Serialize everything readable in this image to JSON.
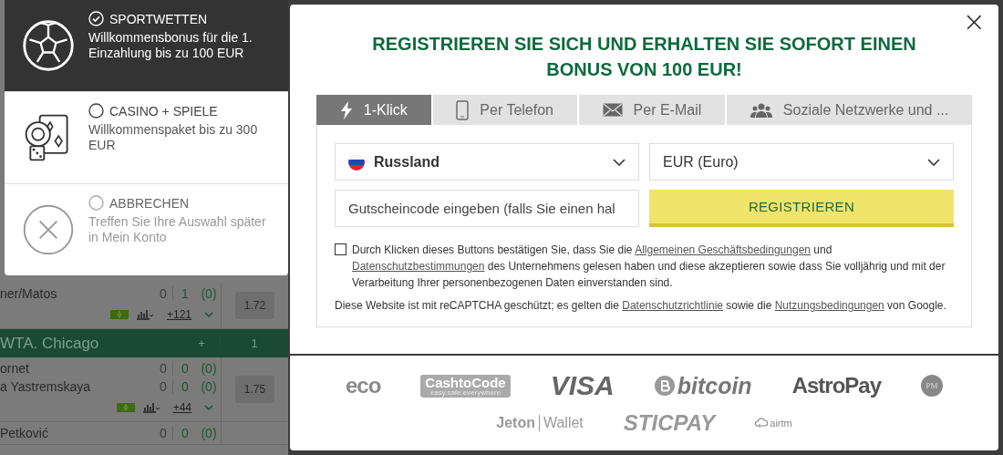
{
  "background": {
    "events": [
      {
        "kind": "match",
        "teams": [
          {
            "name": "ner/Matos",
            "score": "0",
            "games": "1",
            "points": "(0)"
          }
        ],
        "odds": "1.72",
        "markets": "+121"
      },
      {
        "kind": "league",
        "name": "WTA. Chicago",
        "plus": "+",
        "count": "1"
      },
      {
        "kind": "match",
        "teams": [
          {
            "name": "ornet",
            "score": "0",
            "games": "0",
            "points": "(0)"
          },
          {
            "name": "a Yastremskaya",
            "score": "0",
            "games": "0",
            "points": "(0)"
          }
        ],
        "odds": "1.75",
        "markets": "+44"
      },
      {
        "kind": "match",
        "teams": [
          {
            "name": "Petković",
            "score": "0",
            "games": "0",
            "points": "(0)"
          }
        ]
      }
    ]
  },
  "bonus_menu": {
    "options": [
      {
        "kind": "sport",
        "title": "SPORTWETTEN",
        "text": "Willkommensbonus für die 1. Einzahlung bis zu 100 EUR",
        "selected": true,
        "muted": false
      },
      {
        "kind": "casino",
        "title": "CASINO + SPIELE",
        "text": "Willkommenspaket bis zu 300 EUR",
        "selected": false,
        "muted": false
      },
      {
        "kind": "cancel",
        "title": "ABBRECHEN",
        "text": "Treffen Sie Ihre Auswahl später in Mein Konto",
        "selected": false,
        "muted": true
      }
    ]
  },
  "modal": {
    "close": "×",
    "title_lines": [
      "REGISTRIEREN SIE SICH UND ERHALTEN SIE SOFORT EINEN",
      "BONUS VON 100 EUR!"
    ],
    "tabs": [
      {
        "kind": "bolt",
        "label": "1-Klick",
        "selected": true
      },
      {
        "kind": "phone",
        "label": "Per Telefon",
        "selected": false
      },
      {
        "kind": "mail",
        "label": "Per E-Mail",
        "selected": false
      },
      {
        "kind": "people",
        "label": "Soziale Netzwerke und ...",
        "selected": false
      }
    ],
    "country": "Russland",
    "currency": "EUR (Euro)",
    "coupon": {
      "placeholder": "Gutscheincode eingeben (falls Sie einen hal"
    },
    "register_button": "REGISTRIEREN",
    "consent": {
      "checked": false,
      "segments": [
        {
          "text": "Durch Klicken dieses Buttons bestätigen Sie, dass Sie die ",
          "link": false
        },
        {
          "text": "Allgemeinen Geschäftsbedingungen",
          "link": true
        },
        {
          "text": " und ",
          "link": false
        },
        {
          "text": "Datenschutzbestimmungen",
          "link": true
        },
        {
          "text": " des Unternehmens gelesen haben und diese akzeptieren sowie dass Sie volljährig und mit der Verarbeitung Ihrer personenbezogenen Daten einverstanden sind.",
          "link": false
        }
      ]
    },
    "recaptcha": [
      {
        "text": "Diese Website ist mit reCAPTCHA geschützt; es gelten die ",
        "link": false
      },
      {
        "text": "Datenschutzrichtlinie",
        "link": true
      },
      {
        "text": " sowie die ",
        "link": false
      },
      {
        "text": "Nutzungsbedingungen",
        "link": true
      },
      {
        "text": " von Google.",
        "link": false
      }
    ],
    "payment_rows": [
      [
        {
          "kind": "eco",
          "text": "eco"
        },
        {
          "kind": "cashtocode",
          "text": "CashtoCode",
          "sub": "easy.safe.everywhere"
        },
        {
          "kind": "visa",
          "text": "VISA"
        },
        {
          "kind": "bitcoin",
          "text": "bitcoin"
        },
        {
          "kind": "astropay",
          "text": "AstroPay"
        },
        {
          "kind": "pm",
          "text": "PM"
        }
      ],
      [
        {
          "kind": "jeton",
          "text": "Jeton",
          "sub": "Wallet"
        },
        {
          "kind": "sticpay",
          "text": "STICPAY"
        },
        {
          "kind": "airtm",
          "text": "airtm"
        }
      ]
    ]
  }
}
